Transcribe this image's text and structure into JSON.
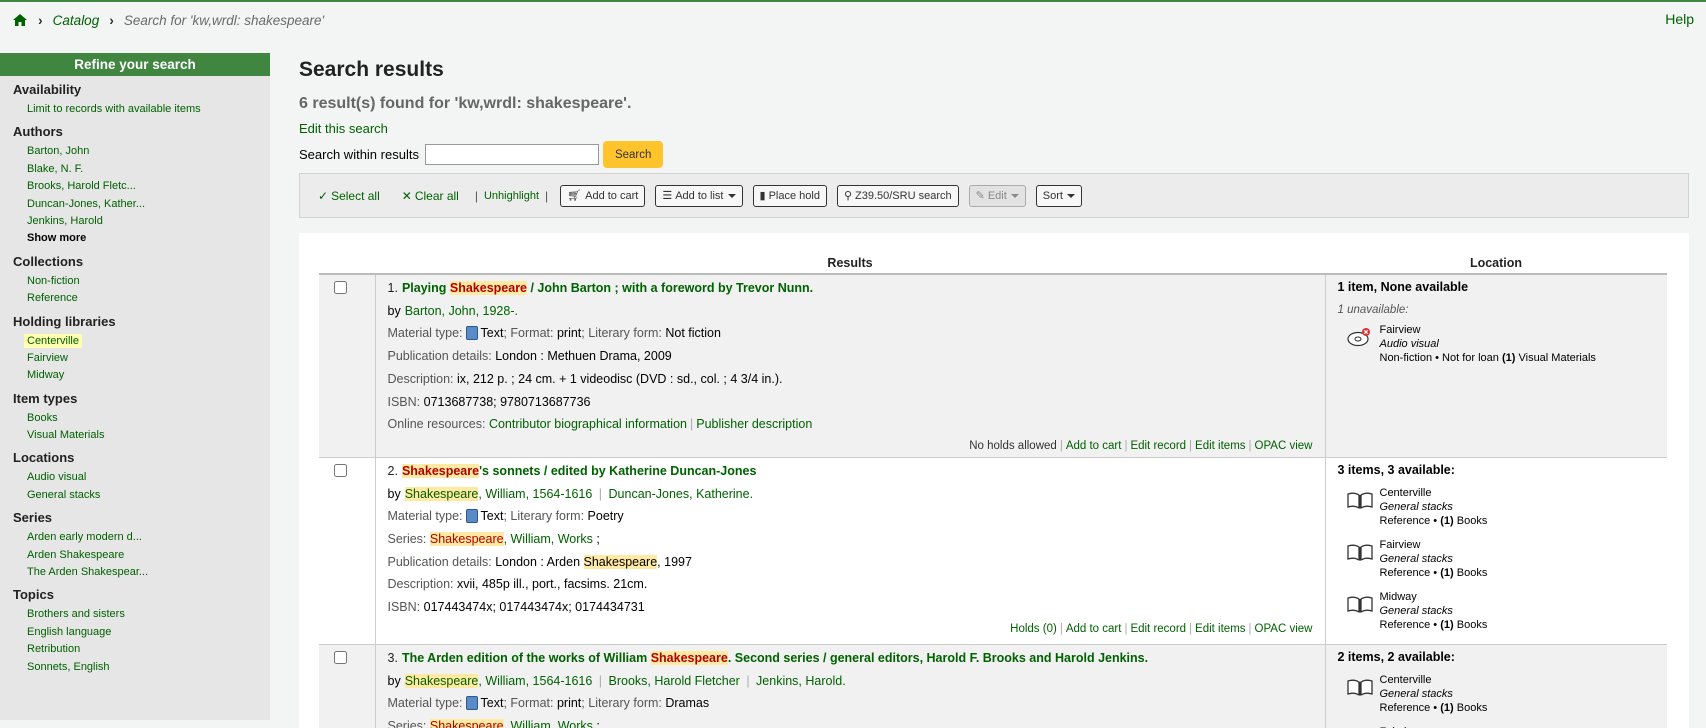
{
  "breadcrumb": {
    "catalog": "Catalog",
    "current": "Search for 'kw,wrdl: shakespeare'",
    "help": "Help"
  },
  "sidebar": {
    "title": "Refine your search",
    "groups": [
      {
        "name": "Availability",
        "items": [
          "Limit to records with available items"
        ]
      },
      {
        "name": "Authors",
        "items": [
          "Barton, John",
          "Blake, N. F.",
          "Brooks, Harold Fletc...",
          "Duncan-Jones, Kather...",
          "Jenkins, Harold"
        ],
        "more": "Show more"
      },
      {
        "name": "Collections",
        "items": [
          "Non-fiction",
          "Reference"
        ]
      },
      {
        "name": "Holding libraries",
        "items": [
          "Centerville",
          "Fairview",
          "Midway"
        ],
        "selected": 0
      },
      {
        "name": "Item types",
        "items": [
          "Books",
          "Visual Materials"
        ]
      },
      {
        "name": "Locations",
        "items": [
          "Audio visual",
          "General stacks"
        ]
      },
      {
        "name": "Series",
        "items": [
          "Arden early modern d...",
          "Arden Shakespeare",
          "The Arden Shakespear..."
        ]
      },
      {
        "name": "Topics",
        "items": [
          "Brothers and sisters",
          "English language",
          "Retribution",
          "Sonnets, English"
        ]
      }
    ]
  },
  "main": {
    "heading": "Search results",
    "count": "6 result(s) found for 'kw,wrdl: shakespeare'.",
    "edit_search": "Edit this search",
    "within_label": "Search within results",
    "within_value": "",
    "search_button": "Search"
  },
  "toolbar": {
    "select_all": "Select all",
    "clear_all": "Clear all",
    "unhighlight": "Unhighlight",
    "add_to_cart": "Add to cart",
    "add_to_list": "Add to list",
    "place_hold": "Place hold",
    "z3950": "Z39.50/SRU search",
    "edit": "Edit",
    "sort": "Sort"
  },
  "table": {
    "col_results": "Results",
    "col_location": "Location"
  },
  "records": [
    {
      "num": "1.",
      "title_pre": "Playing ",
      "title_hl": "Shakespeare",
      "title_post": " / John Barton ; with a foreword by Trevor Nunn.",
      "by": "by",
      "author": "Barton, John, 1928-.",
      "mt_label": "Material type:",
      "mt": "Text",
      "fmt_label": "; Format:",
      "fmt": "print",
      "lf_label": "; Literary form:",
      "lf": "Not fiction",
      "pub_label": "Publication details:",
      "pub": "London : Methuen Drama, 2009",
      "desc_label": "Description:",
      "desc": "ix, 212 p. ; 24 cm. + 1 videodisc (DVD : sd., col. ; 4 3/4 in.).",
      "isbn_label": "ISBN:",
      "isbn": "0713687738; 9780713687736",
      "online_label": "Online resources:",
      "online1": "Contributor biographical information",
      "online2": "Publisher description",
      "holds": "No holds allowed",
      "add_cart": "Add to cart",
      "edit_record": "Edit record",
      "edit_items": "Edit items",
      "opac": "OPAC view",
      "loc_head": "1 item, None available",
      "unavailable": "1 unavailable:",
      "items": [
        {
          "lib": "Fairview",
          "loc": "Audio visual",
          "detail": "Non-fiction • Not for loan",
          "count": "(1)",
          "type": "Visual Materials"
        }
      ]
    },
    {
      "num": "2.",
      "title_hl": "Shakespeare",
      "title_post": "'s sonnets / edited by Katherine Duncan-Jones",
      "by": "by",
      "author_hl": "Shakespeare",
      "author_post": ", William, 1564-1616",
      "author2": "Duncan-Jones, Katherine.",
      "mt_label": "Material type:",
      "mt": "Text",
      "lf_label": "; Literary form:",
      "lf": "Poetry",
      "series_label": "Series:",
      "series_hl": "Shakespeare",
      "series_post": ", William, Works",
      "series_end": " ;",
      "pub_label": "Publication details:",
      "pub_pre": "London : Arden ",
      "pub_hl": "Shakespeare",
      "pub_post": ", 1997",
      "desc_label": "Description:",
      "desc": "xvii, 485p ill., port., facsims. 21cm.",
      "isbn_label": "ISBN:",
      "isbn": "017443474x; 017443474x; 0174434731",
      "holds": "Holds (0)",
      "add_cart": "Add to cart",
      "edit_record": "Edit record",
      "edit_items": "Edit items",
      "opac": "OPAC view",
      "loc_head": "3 items, 3 available:",
      "items": [
        {
          "lib": "Centerville",
          "loc": "General stacks",
          "detail": "Reference •",
          "count": "(1)",
          "type": "Books"
        },
        {
          "lib": "Fairview",
          "loc": "General stacks",
          "detail": "Reference •",
          "count": "(1)",
          "type": "Books"
        },
        {
          "lib": "Midway",
          "loc": "General stacks",
          "detail": "Reference •",
          "count": "(1)",
          "type": "Books"
        }
      ]
    },
    {
      "num": "3.",
      "title_pre": "The Arden edition of the works of William ",
      "title_hl": "Shakespeare",
      "title_post": ". Second series / general editors, Harold F. Brooks and Harold Jenkins.",
      "by": "by",
      "author_hl": "Shakespeare",
      "author_post": ", William, 1564-1616",
      "author2": "Brooks, Harold Fletcher",
      "author3": "Jenkins, Harold.",
      "mt_label": "Material type:",
      "mt": "Text",
      "fmt_label": "; Format:",
      "fmt": "print",
      "lf_label": "; Literary form:",
      "lf": "Dramas",
      "series_label": "Series:",
      "series_hl": "Shakespeare",
      "series_post": ", William, Works",
      "series_end": " ;",
      "loc_head": "2 items, 2 available:",
      "items": [
        {
          "lib": "Centerville",
          "loc": "General stacks",
          "detail": "Reference •",
          "count": "(1)",
          "type": "Books"
        },
        {
          "lib": "Fairview"
        }
      ]
    }
  ]
}
